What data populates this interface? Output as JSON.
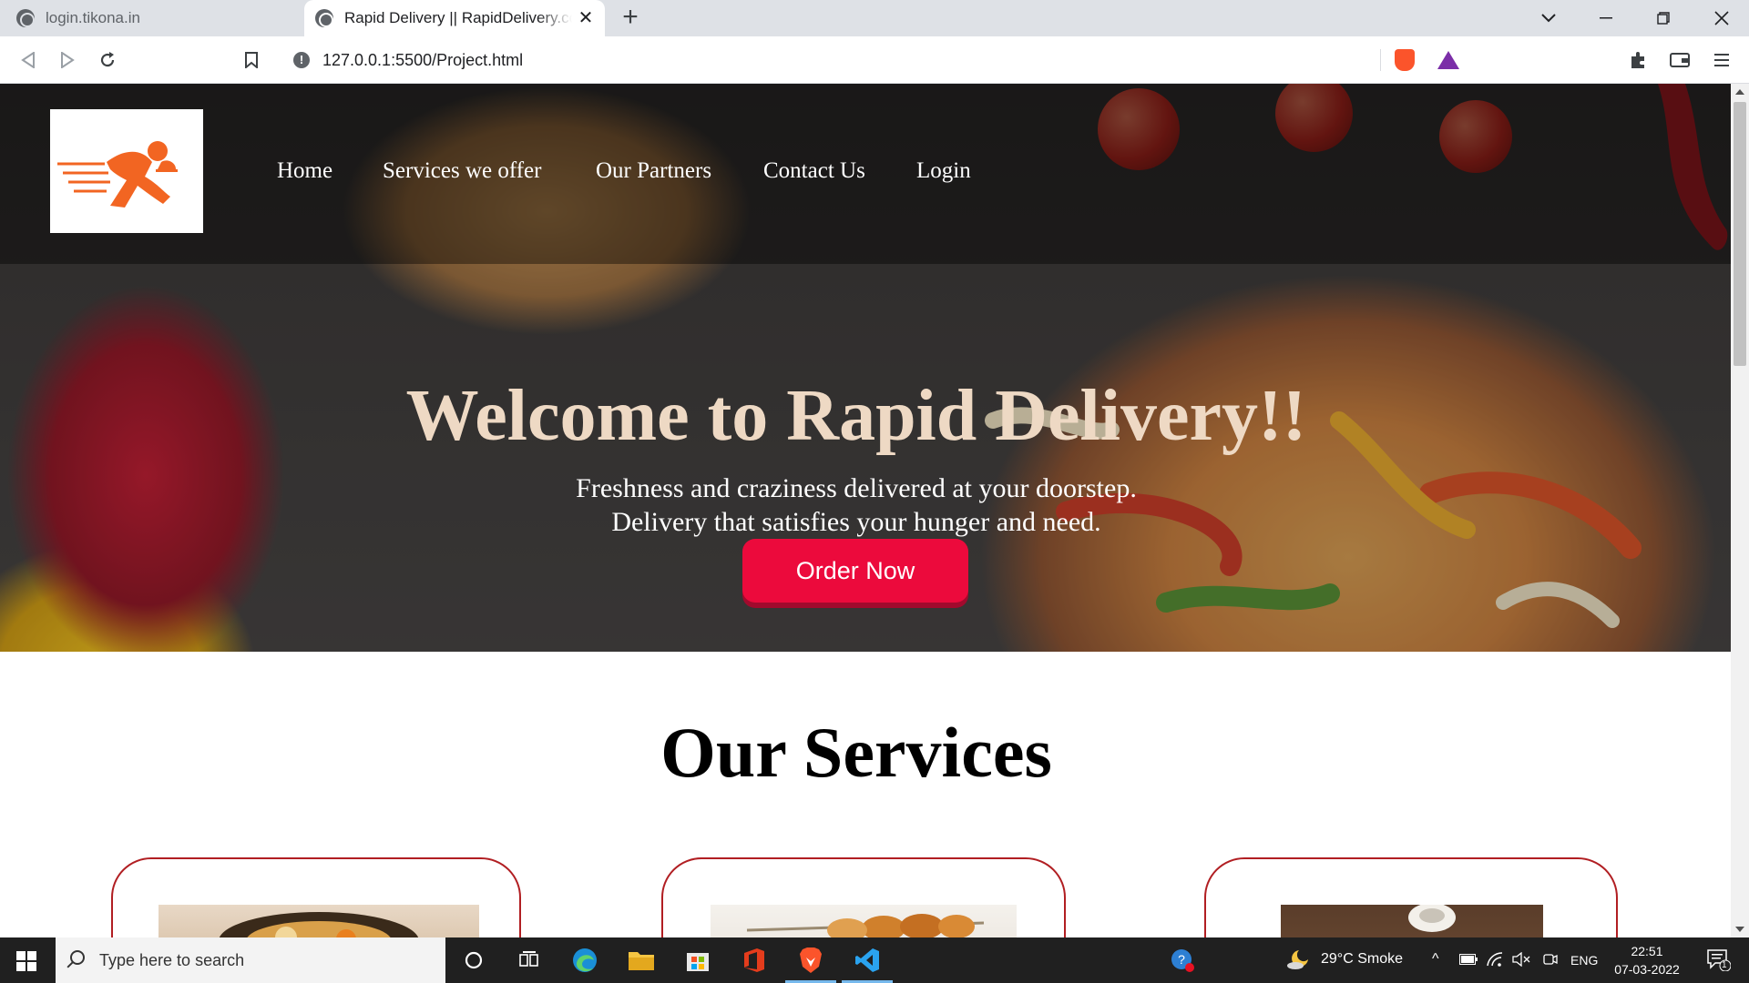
{
  "browser": {
    "tabs": [
      {
        "title": "login.tikona.in",
        "active": false
      },
      {
        "title": "Rapid Delivery || RapidDelivery.com",
        "active": true
      }
    ],
    "new_tab_symbol": "+",
    "close_symbol": "✕",
    "url": "127.0.0.1:5500/Project.html",
    "icons": [
      "back-icon",
      "forward-icon",
      "reload-icon",
      "bookmark-icon",
      "site-info-icon",
      "brave-shields-icon",
      "brave-rewards-icon",
      "extensions-icon",
      "wallet-icon",
      "menu-icon"
    ],
    "window_controls": {
      "tab_search": "⌄",
      "minimize": "—",
      "restore": "❐",
      "close": "✕"
    }
  },
  "page": {
    "nav": {
      "logo_alt": "Rapid Delivery logo",
      "links": [
        "Home",
        "Services we offer",
        "Our Partners",
        "Contact Us",
        "Login"
      ]
    },
    "hero": {
      "title": "Welcome to Rapid Delivery!!",
      "subtitle_line1": "Freshness and craziness delivered at your doorstep.",
      "subtitle_line2": "Delivery that satisfies your hunger and need.",
      "cta": "Order Now"
    },
    "services": {
      "heading": "Our Services",
      "cards": 3
    }
  },
  "taskbar": {
    "search_placeholder": "Type here to search",
    "apps": [
      "cortana-icon",
      "task-view-icon",
      "edge-icon",
      "file-explorer-icon",
      "microsoft-store-icon",
      "office-icon",
      "brave-icon",
      "vscode-icon"
    ],
    "weather": "29°C  Smoke",
    "language": "ENG",
    "time": "22:51",
    "date": "07-03-2022",
    "notification_count": "1"
  },
  "colors": {
    "accent_button": "#ec0a3c",
    "hero_title": "#eed9c4",
    "card_border": "#b11e22",
    "logo_orange": "#f26522"
  }
}
